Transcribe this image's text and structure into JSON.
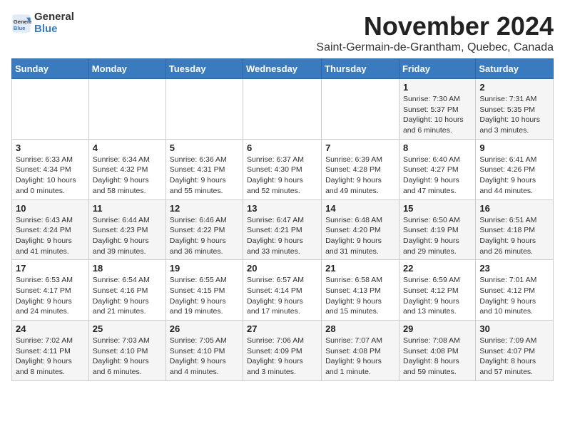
{
  "logo": {
    "text_general": "General",
    "text_blue": "Blue"
  },
  "header": {
    "month_year": "November 2024",
    "location": "Saint-Germain-de-Grantham, Quebec, Canada"
  },
  "weekdays": [
    "Sunday",
    "Monday",
    "Tuesday",
    "Wednesday",
    "Thursday",
    "Friday",
    "Saturday"
  ],
  "weeks": [
    [
      {
        "day": "",
        "info": ""
      },
      {
        "day": "",
        "info": ""
      },
      {
        "day": "",
        "info": ""
      },
      {
        "day": "",
        "info": ""
      },
      {
        "day": "",
        "info": ""
      },
      {
        "day": "1",
        "info": "Sunrise: 7:30 AM\nSunset: 5:37 PM\nDaylight: 10 hours and 6 minutes."
      },
      {
        "day": "2",
        "info": "Sunrise: 7:31 AM\nSunset: 5:35 PM\nDaylight: 10 hours and 3 minutes."
      }
    ],
    [
      {
        "day": "3",
        "info": "Sunrise: 6:33 AM\nSunset: 4:34 PM\nDaylight: 10 hours and 0 minutes."
      },
      {
        "day": "4",
        "info": "Sunrise: 6:34 AM\nSunset: 4:32 PM\nDaylight: 9 hours and 58 minutes."
      },
      {
        "day": "5",
        "info": "Sunrise: 6:36 AM\nSunset: 4:31 PM\nDaylight: 9 hours and 55 minutes."
      },
      {
        "day": "6",
        "info": "Sunrise: 6:37 AM\nSunset: 4:30 PM\nDaylight: 9 hours and 52 minutes."
      },
      {
        "day": "7",
        "info": "Sunrise: 6:39 AM\nSunset: 4:28 PM\nDaylight: 9 hours and 49 minutes."
      },
      {
        "day": "8",
        "info": "Sunrise: 6:40 AM\nSunset: 4:27 PM\nDaylight: 9 hours and 47 minutes."
      },
      {
        "day": "9",
        "info": "Sunrise: 6:41 AM\nSunset: 4:26 PM\nDaylight: 9 hours and 44 minutes."
      }
    ],
    [
      {
        "day": "10",
        "info": "Sunrise: 6:43 AM\nSunset: 4:24 PM\nDaylight: 9 hours and 41 minutes."
      },
      {
        "day": "11",
        "info": "Sunrise: 6:44 AM\nSunset: 4:23 PM\nDaylight: 9 hours and 39 minutes."
      },
      {
        "day": "12",
        "info": "Sunrise: 6:46 AM\nSunset: 4:22 PM\nDaylight: 9 hours and 36 minutes."
      },
      {
        "day": "13",
        "info": "Sunrise: 6:47 AM\nSunset: 4:21 PM\nDaylight: 9 hours and 33 minutes."
      },
      {
        "day": "14",
        "info": "Sunrise: 6:48 AM\nSunset: 4:20 PM\nDaylight: 9 hours and 31 minutes."
      },
      {
        "day": "15",
        "info": "Sunrise: 6:50 AM\nSunset: 4:19 PM\nDaylight: 9 hours and 29 minutes."
      },
      {
        "day": "16",
        "info": "Sunrise: 6:51 AM\nSunset: 4:18 PM\nDaylight: 9 hours and 26 minutes."
      }
    ],
    [
      {
        "day": "17",
        "info": "Sunrise: 6:53 AM\nSunset: 4:17 PM\nDaylight: 9 hours and 24 minutes."
      },
      {
        "day": "18",
        "info": "Sunrise: 6:54 AM\nSunset: 4:16 PM\nDaylight: 9 hours and 21 minutes."
      },
      {
        "day": "19",
        "info": "Sunrise: 6:55 AM\nSunset: 4:15 PM\nDaylight: 9 hours and 19 minutes."
      },
      {
        "day": "20",
        "info": "Sunrise: 6:57 AM\nSunset: 4:14 PM\nDaylight: 9 hours and 17 minutes."
      },
      {
        "day": "21",
        "info": "Sunrise: 6:58 AM\nSunset: 4:13 PM\nDaylight: 9 hours and 15 minutes."
      },
      {
        "day": "22",
        "info": "Sunrise: 6:59 AM\nSunset: 4:12 PM\nDaylight: 9 hours and 13 minutes."
      },
      {
        "day": "23",
        "info": "Sunrise: 7:01 AM\nSunset: 4:12 PM\nDaylight: 9 hours and 10 minutes."
      }
    ],
    [
      {
        "day": "24",
        "info": "Sunrise: 7:02 AM\nSunset: 4:11 PM\nDaylight: 9 hours and 8 minutes."
      },
      {
        "day": "25",
        "info": "Sunrise: 7:03 AM\nSunset: 4:10 PM\nDaylight: 9 hours and 6 minutes."
      },
      {
        "day": "26",
        "info": "Sunrise: 7:05 AM\nSunset: 4:10 PM\nDaylight: 9 hours and 4 minutes."
      },
      {
        "day": "27",
        "info": "Sunrise: 7:06 AM\nSunset: 4:09 PM\nDaylight: 9 hours and 3 minutes."
      },
      {
        "day": "28",
        "info": "Sunrise: 7:07 AM\nSunset: 4:08 PM\nDaylight: 9 hours and 1 minute."
      },
      {
        "day": "29",
        "info": "Sunrise: 7:08 AM\nSunset: 4:08 PM\nDaylight: 8 hours and 59 minutes."
      },
      {
        "day": "30",
        "info": "Sunrise: 7:09 AM\nSunset: 4:07 PM\nDaylight: 8 hours and 57 minutes."
      }
    ]
  ]
}
